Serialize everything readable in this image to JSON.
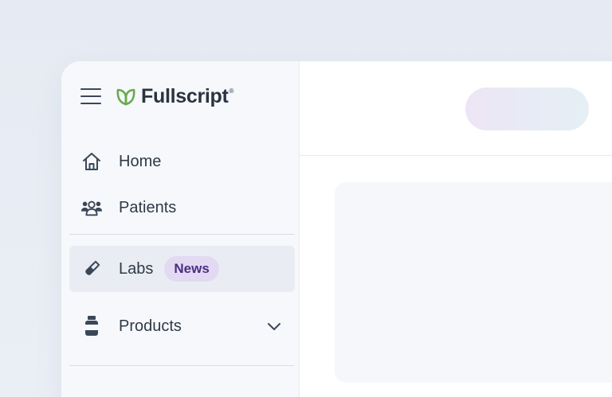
{
  "brand": {
    "name": "Fullscript",
    "registered_mark": "®",
    "logo_icon": "leaf-icon",
    "logo_color": "#6aa84f"
  },
  "menu_icon": "hamburger-menu-icon",
  "nav": {
    "items": [
      {
        "label": "Home",
        "icon": "home-icon"
      },
      {
        "label": "Patients",
        "icon": "patients-icon"
      },
      {
        "label": "Labs",
        "icon": "test-tube-icon",
        "badge": "News",
        "active": true
      },
      {
        "label": "Products",
        "icon": "supplement-bottle-icon",
        "expandable": true
      }
    ]
  },
  "colors": {
    "badge_bg": "#e3d9f3",
    "badge_text": "#4b2e83",
    "active_bg": "#e9edf3"
  }
}
